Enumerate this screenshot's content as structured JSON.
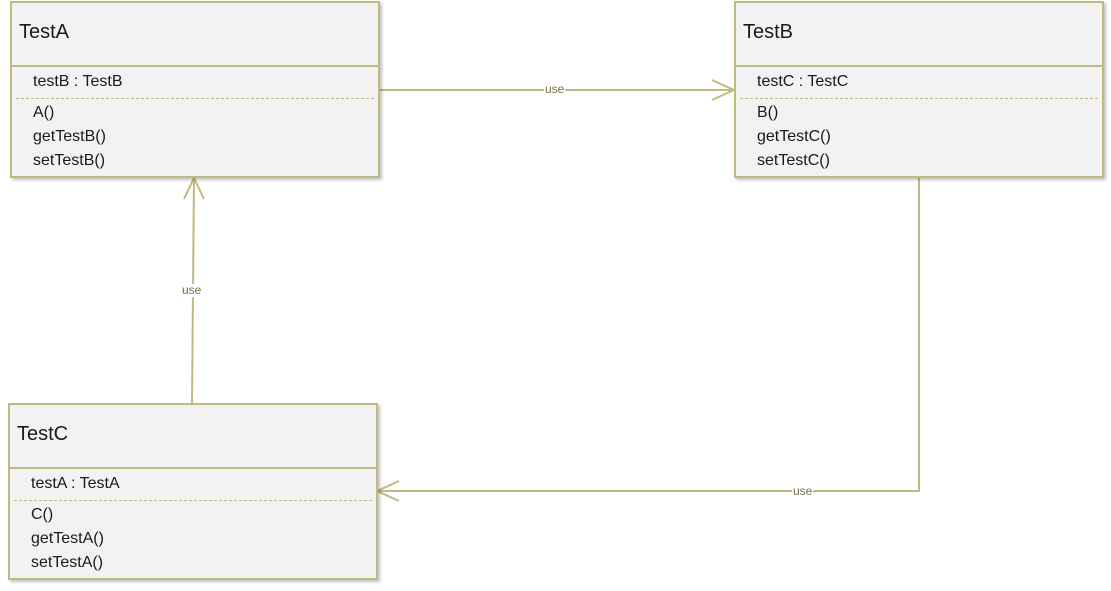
{
  "classes": {
    "a": {
      "name": "TestA",
      "attribute": "testB : TestB",
      "operations": [
        "A()",
        "getTestB()",
        "setTestB()"
      ]
    },
    "b": {
      "name": "TestB",
      "attribute": "testC : TestC",
      "operations": [
        "B()",
        "getTestC()",
        "setTestC()"
      ]
    },
    "c": {
      "name": "TestC",
      "attribute": "testA : TestA",
      "operations": [
        "C()",
        "getTestA()",
        "setTestA()"
      ]
    }
  },
  "relations": [
    {
      "from": "TestA",
      "to": "TestB",
      "label": "use"
    },
    {
      "from": "TestB",
      "to": "TestC",
      "label": "use"
    },
    {
      "from": "TestC",
      "to": "TestA",
      "label": "use"
    }
  ],
  "colors": {
    "border": "#c2b97e",
    "fill": "#f2f2f2",
    "label": "#7a7040"
  }
}
